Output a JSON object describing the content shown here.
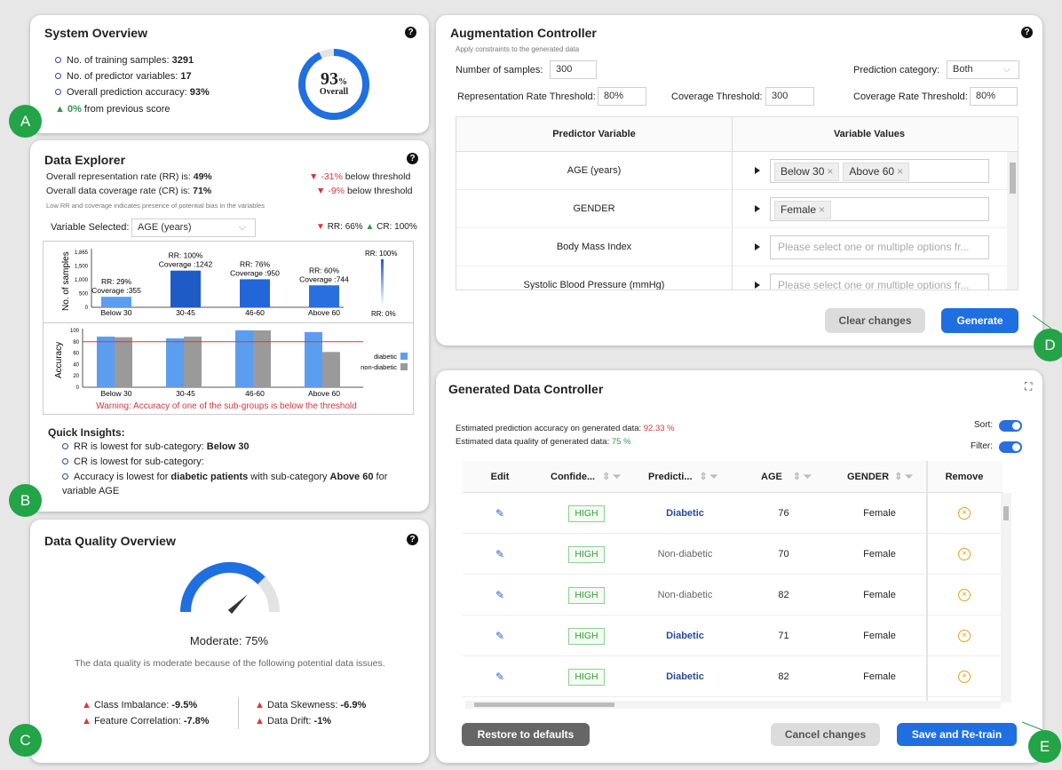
{
  "system": {
    "title": "System Overview",
    "help": "?",
    "items": [
      {
        "label": "No. of training samples: ",
        "value": "3291"
      },
      {
        "label": "No. of predictor variables: ",
        "value": "17"
      },
      {
        "label": "Overall prediction accuracy: ",
        "value": "93%"
      }
    ],
    "delta_value": "0%",
    "delta_text": " from previous score",
    "gauge_value": "93",
    "gauge_unit": "%",
    "gauge_label": "Overall",
    "gauge_fraction": 0.93
  },
  "explorer": {
    "title": "Data Explorer",
    "help": "?",
    "rr_label": "Overall representation rate (RR) is: ",
    "rr_value": "49%",
    "rr_delta": "-31%",
    "rr_below": "below threshold",
    "cr_label": "Overall data coverage rate (CR) is: ",
    "cr_value": "71%",
    "cr_delta": "-9%",
    "cr_below": "below threshold",
    "note": "Low RR and coverage indicates presence of potential bias in the variables",
    "var_label": "Variable Selected:",
    "var_value": "AGE (years)",
    "rr_stat": "RR: 66%",
    "cr_stat": "CR: 100%",
    "warning": "Warning: Accuracy of one of the sub-groups is below the threshold",
    "insights_title": "Quick Insights:",
    "insight1_a": "RR is lowest for sub-category: ",
    "insight1_b": "Below 30",
    "insight2": "CR is lowest for sub-category:",
    "insight3_a": "Accuracy is lowest for ",
    "insight3_b": "diabetic patients",
    "insight3_c": " with sub-category ",
    "insight3_d": "Above 60",
    "insight3_e": " for",
    "insight3_f": "variable AGE"
  },
  "chart_data": [
    {
      "type": "bar",
      "ylabel": "No. of samples",
      "categories": [
        "Below 30",
        "30-45",
        "46-60",
        "Above 60"
      ],
      "values": [
        355,
        1242,
        950,
        744
      ],
      "rr": [
        "RR: 29%",
        "RR: 100%",
        "RR: 76%",
        "RR: 60%"
      ],
      "coverage": [
        "Coverage :355",
        "Coverage :1242",
        "Coverage :950",
        "Coverage :744"
      ],
      "yticks": [
        "1,865",
        "1,500",
        "1,000",
        "500",
        "0"
      ],
      "ylim": [
        0,
        1865
      ],
      "legend_top": "RR: 100%",
      "legend_bottom": "RR: 0%",
      "colors": [
        "#5b9ef0",
        "#1e5bc6",
        "#2266d8",
        "#2a6fe0"
      ]
    },
    {
      "type": "bar",
      "ylabel": "Accuracy",
      "categories": [
        "Below 30",
        "30-45",
        "46-60",
        "Above 60"
      ],
      "series": [
        {
          "name": "diabetic",
          "values": [
            89,
            86,
            100,
            97
          ],
          "color": "#5b9ef0"
        },
        {
          "name": "non-diabetic",
          "values": [
            88,
            89,
            100,
            62
          ],
          "color": "#9a9a9a"
        }
      ],
      "yticks": [
        "100",
        "80",
        "60",
        "40",
        "20",
        "0"
      ],
      "ylim": [
        0,
        100
      ],
      "threshold": 80
    }
  ],
  "quality": {
    "title": "Data Quality Overview",
    "help": "?",
    "label": "Moderate: 75%",
    "fraction": 0.75,
    "desc": "The data quality is moderate because of the following potential data issues.",
    "issues": [
      {
        "label": "Class Imbalance: ",
        "value": "-9.5%"
      },
      {
        "label": "Feature Correlation: ",
        "value": "-7.8%"
      },
      {
        "label": "Data Skewness: ",
        "value": "-6.9%"
      },
      {
        "label": "Data Drift: ",
        "value": "-1%"
      }
    ]
  },
  "augment": {
    "title": "Augmentation Controller",
    "help": "?",
    "subtitle": "Apply constraints to the generated data",
    "samples_label": "Number of samples:",
    "samples_value": "300",
    "category_label": "Prediction category:",
    "category_value": "Both",
    "rr_label": "Representation Rate Threshold:",
    "rr_value": "80%",
    "cov_label": "Coverage Threshold:",
    "cov_value": "300",
    "covr_label": "Coverage Rate Threshold:",
    "covr_value": "80%",
    "col1": "Predictor Variable",
    "col2": "Variable Values",
    "rows": [
      {
        "name": "AGE (years)",
        "tags": [
          "Below 30",
          "Above 60"
        ]
      },
      {
        "name": "GENDER",
        "tags": [
          "Female"
        ]
      },
      {
        "name": "Body Mass Index",
        "placeholder": "Please select one or multiple options fr..."
      },
      {
        "name": "Systolic Blood Pressure (mmHg)",
        "placeholder": "Please select one or multiple options fr..."
      }
    ],
    "clear": "Clear changes",
    "generate": "Generate"
  },
  "generated": {
    "title": "Generated Data Controller",
    "acc_label": "Estimated prediction accuracy on generated data: ",
    "acc_value": "92.33 %",
    "qual_label": "Estimated data quality of generated data: ",
    "qual_value": "75 %",
    "sort": "Sort:",
    "filter": "Filter:",
    "cols": [
      "Edit",
      "Confide...",
      "Predicti...",
      "AGE",
      "GENDER",
      "Remove"
    ],
    "rows": [
      {
        "conf": "HIGH",
        "pred": "Diabetic",
        "age": "76",
        "gender": "Female"
      },
      {
        "conf": "HIGH",
        "pred": "Non-diabetic",
        "age": "70",
        "gender": "Female"
      },
      {
        "conf": "HIGH",
        "pred": "Non-diabetic",
        "age": "82",
        "gender": "Female"
      },
      {
        "conf": "HIGH",
        "pred": "Diabetic",
        "age": "71",
        "gender": "Female"
      },
      {
        "conf": "HIGH",
        "pred": "Diabetic",
        "age": "82",
        "gender": "Female"
      }
    ],
    "restore": "Restore to defaults",
    "cancel": "Cancel changes",
    "save": "Save and Re-train"
  },
  "markers": [
    "A",
    "B",
    "C",
    "D",
    "E"
  ]
}
